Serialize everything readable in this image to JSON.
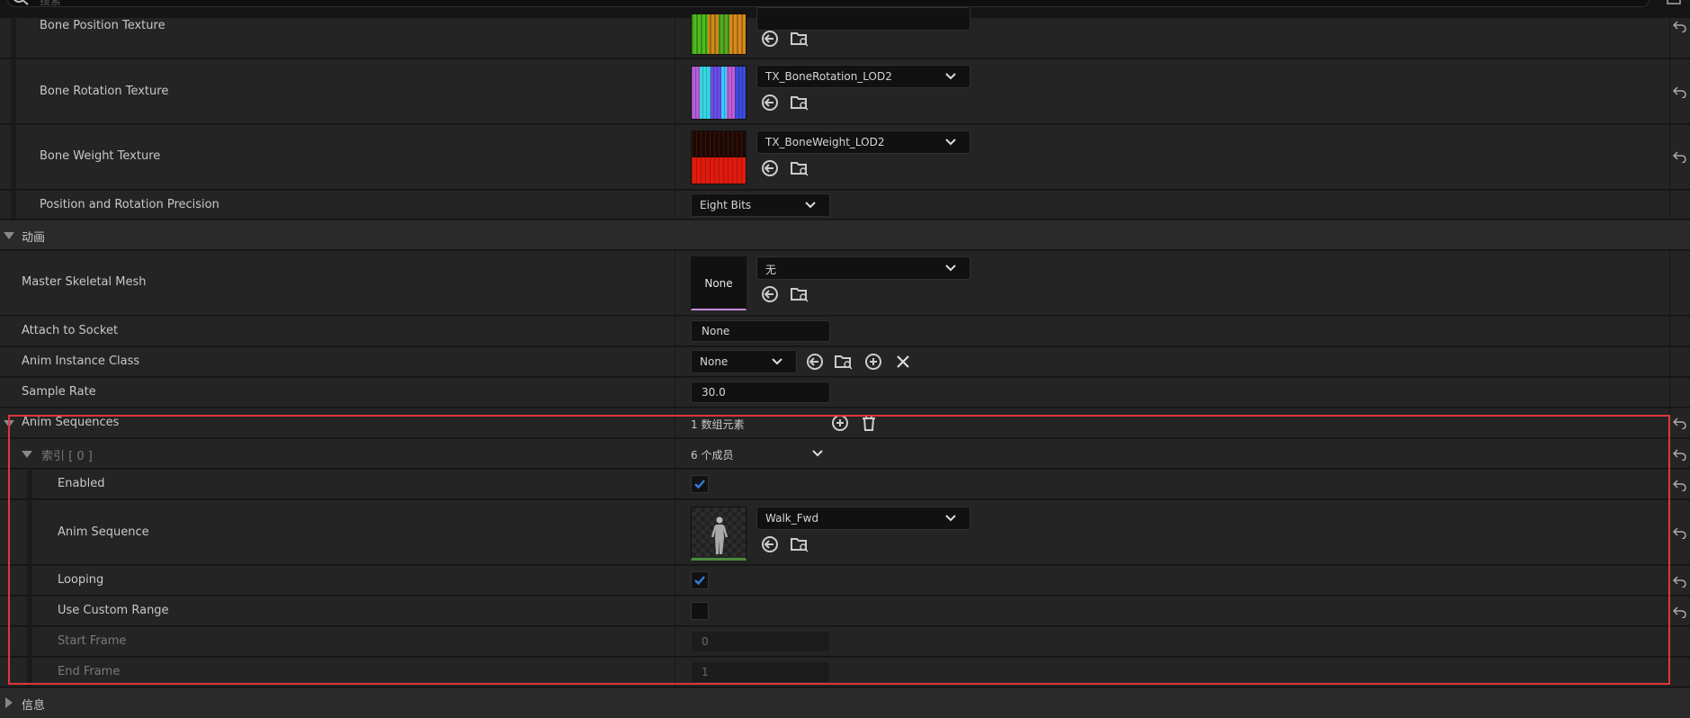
{
  "search": {
    "placeholder": "搜索"
  },
  "texture_rows": [
    {
      "label": "Bone Position Texture",
      "value": ""
    },
    {
      "label": "Bone Rotation Texture",
      "value": "TX_BoneRotation_LOD2"
    },
    {
      "label": "Bone Weight Texture",
      "value": "TX_BoneWeight_LOD2"
    }
  ],
  "precision": {
    "label": "Position and Rotation Precision",
    "value": "Eight Bits"
  },
  "animation_category": {
    "label": "动画"
  },
  "master_mesh": {
    "label": "Master Skeletal Mesh",
    "thumb_text": "None",
    "value": "无"
  },
  "socket": {
    "label": "Attach to Socket",
    "value": "None"
  },
  "anim_class": {
    "label": "Anim Instance Class",
    "value": "None"
  },
  "sample_rate": {
    "label": "Sample Rate",
    "value": "30.0"
  },
  "anim_sequences": {
    "label": "Anim Sequences",
    "count": "1 数组元素"
  },
  "index0": {
    "label": "索引 [ 0 ]",
    "members": "6 个成员"
  },
  "enabled": {
    "label": "Enabled",
    "checked": true
  },
  "anim_sequence": {
    "label": "Anim Sequence",
    "value": "Walk_Fwd"
  },
  "looping": {
    "label": "Looping",
    "checked": true
  },
  "custom_range": {
    "label": "Use Custom Range",
    "checked": false
  },
  "start_frame": {
    "label": "Start Frame",
    "value": "0"
  },
  "end_frame": {
    "label": "End Frame",
    "value": "1"
  },
  "info_category": {
    "label": "信息"
  },
  "colors": {
    "highlight": "#e0363a",
    "check": "#2f7fe0",
    "background": "#242424"
  }
}
